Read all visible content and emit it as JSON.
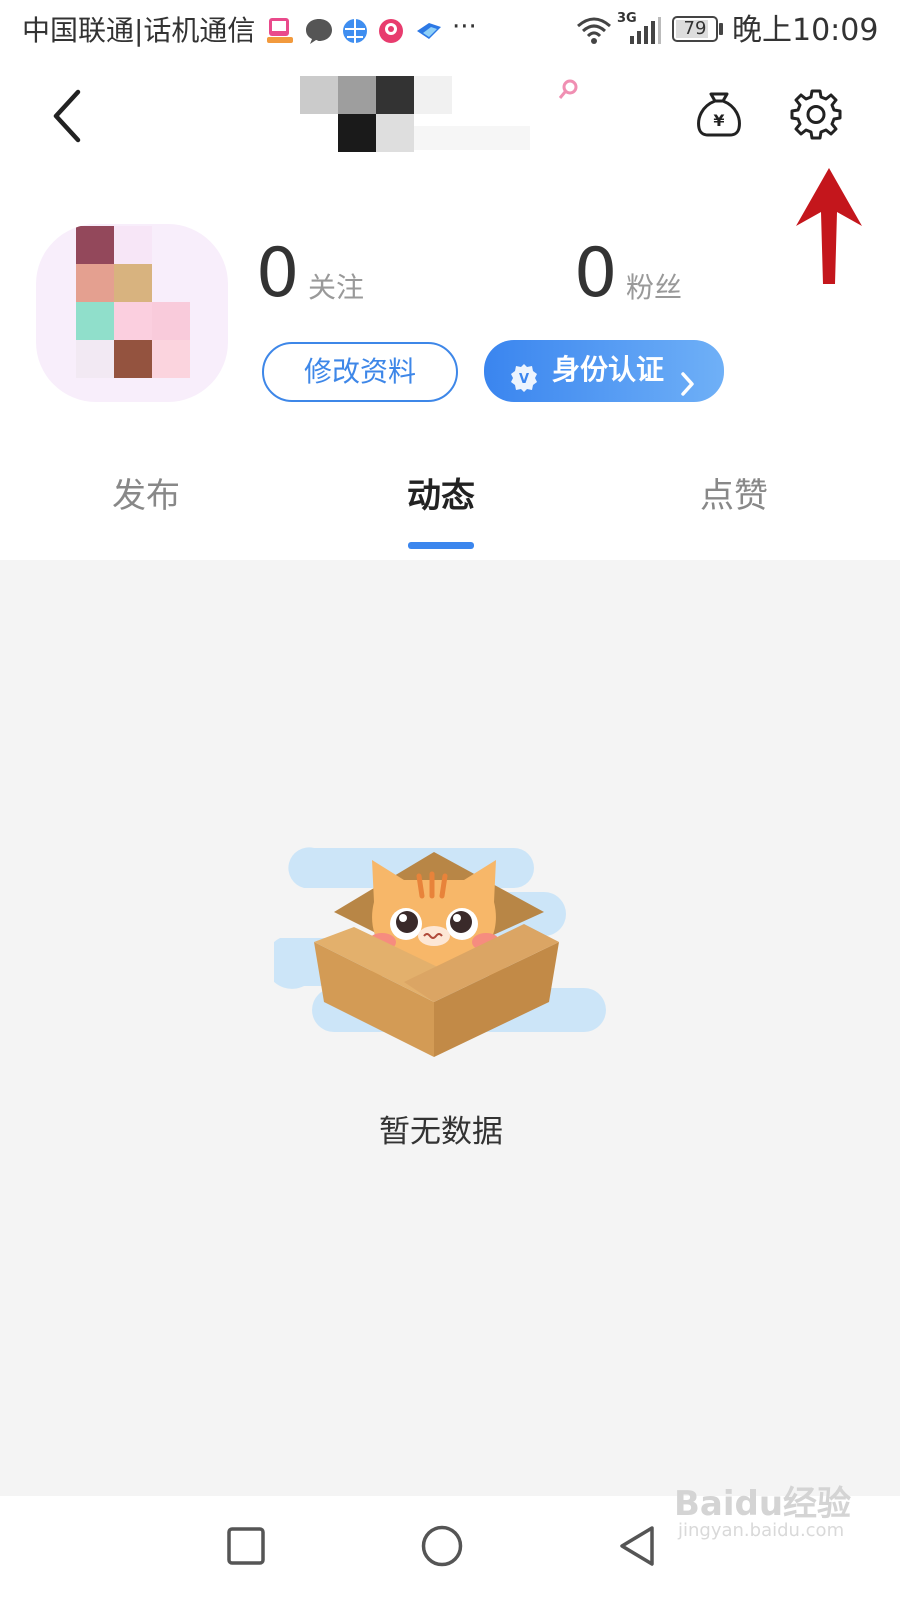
{
  "status_bar": {
    "carrier": "中国联通|话机通信",
    "more": "···",
    "network": "3G",
    "battery": "79",
    "time": "晚上10:09"
  },
  "header": {
    "actions": [
      "wallet-icon",
      "settings-icon"
    ]
  },
  "profile": {
    "following": {
      "count": "0",
      "label": "关注"
    },
    "followers": {
      "count": "0",
      "label": "粉丝"
    },
    "edit_button": "修改资料",
    "verify_button": "身份认证"
  },
  "tabs": [
    {
      "label": "发布",
      "active": false
    },
    {
      "label": "动态",
      "active": true
    },
    {
      "label": "点赞",
      "active": false
    }
  ],
  "empty_state": {
    "message": "暂无数据"
  },
  "colors": {
    "accent": "#3b86ee",
    "annotation_arrow": "#c4161c"
  },
  "watermark": {
    "logo": "Baidu经验",
    "url": "jingyan.baidu.com"
  }
}
